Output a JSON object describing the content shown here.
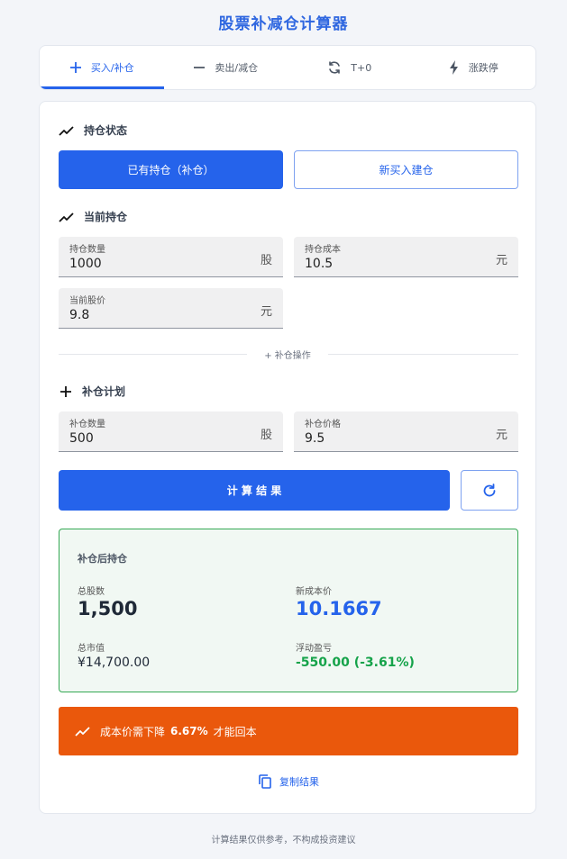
{
  "app": {
    "title": "股票补减仓计算器"
  },
  "tabs": [
    {
      "label": "买入/补仓",
      "icon": "plus-icon",
      "active": true
    },
    {
      "label": "卖出/减仓",
      "icon": "minus-icon",
      "active": false
    },
    {
      "label": "T+0",
      "icon": "refresh-icon",
      "active": false
    },
    {
      "label": "涨跌停",
      "icon": "bolt-icon",
      "active": false
    }
  ],
  "position_status": {
    "title": "持仓状态",
    "options": [
      "已有持仓（补仓）",
      "新买入建仓"
    ],
    "selected": "已有持仓（补仓）"
  },
  "current_position": {
    "title": "当前持仓",
    "shares": {
      "label": "持仓数量",
      "value": "1000",
      "unit": "股"
    },
    "cost": {
      "label": "持仓成本",
      "value": "10.5",
      "unit": "元"
    },
    "price": {
      "label": "当前股价",
      "value": "9.8",
      "unit": "元"
    }
  },
  "divider": {
    "label": "+ 补仓操作"
  },
  "plan": {
    "title": "补仓计划",
    "shares": {
      "label": "补仓数量",
      "value": "500",
      "unit": "股"
    },
    "price": {
      "label": "补仓价格",
      "value": "9.5",
      "unit": "元"
    }
  },
  "actions": {
    "calculate": "计 算 结 果",
    "reset_icon": "refresh-icon"
  },
  "result": {
    "title": "补仓后持仓",
    "total_shares": {
      "label": "总股数",
      "value": "1,500"
    },
    "new_cost": {
      "label": "新成本价",
      "value": "10.1667"
    },
    "market_value": {
      "label": "总市值",
      "value": "¥14,700.00"
    },
    "pnl": {
      "label": "浮动盈亏",
      "value": "-550.00 (-3.61%)"
    }
  },
  "alert": {
    "prefix": "成本价需下降",
    "value": "6.67%",
    "suffix": "才能回本"
  },
  "copy": {
    "label": "复制结果"
  },
  "footer": {
    "text": "计算结果仅供参考，不构成投资建议"
  },
  "colors": {
    "accent": "#2563eb",
    "success": "#16a34a",
    "warning": "#ea580c",
    "bg": "#f3f5f9"
  }
}
